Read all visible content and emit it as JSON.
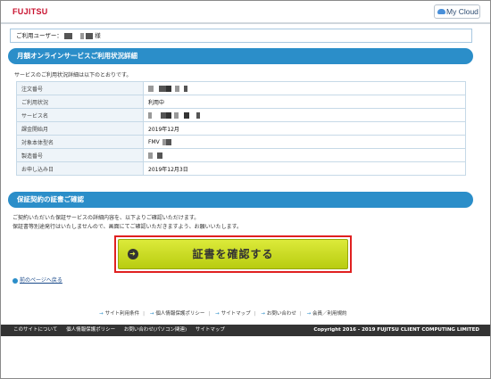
{
  "header": {
    "logo_text": "FUJITSU",
    "mycloud_label": "My Cloud"
  },
  "user": {
    "label": "ご利用ユーザー：",
    "suffix": "様"
  },
  "usage_section": {
    "title": "月額オンラインサービスご利用状況詳細",
    "intro": "サービスのご利用状況詳細は以下のとおりです。",
    "rows": [
      {
        "label": "注文番号",
        "value": ""
      },
      {
        "label": "ご利用状況",
        "value": "利用中"
      },
      {
        "label": "サービス名",
        "value": ""
      },
      {
        "label": "課金開始月",
        "value": "2019年12月"
      },
      {
        "label": "対象本体型名",
        "value": "FMV"
      },
      {
        "label": "製造番号",
        "value": ""
      },
      {
        "label": "お申し込み日",
        "value": "2019年12月3日"
      }
    ]
  },
  "warranty_section": {
    "title": "保証契約の証書ご確認",
    "desc_line1": "ご契約いただいた保証サービスの詳細内容を、以下よりご確認いただけます。",
    "desc_line2": "保証書等別途発行はいたしませんので、画面にてご確認いただきますよう、お願いいたします。",
    "confirm_button": "証書を確認する"
  },
  "back_link": "前のページへ戻る",
  "footer_nav": [
    "サイト利用条件",
    "個人情報保護ポリシー",
    "サイトマップ",
    "お問い合わせ",
    "会員／利用規約"
  ],
  "footer": {
    "links": [
      "このサイトについて",
      "個人情報保護ポリシー",
      "お問い合わせ(パソコン関連)",
      "サイトマップ"
    ],
    "copyright": "Copyright 2016 - 2019 FUJITSU CLIENT COMPUTING LIMITED"
  },
  "colors": {
    "brand_red": "#c8102e",
    "section_blue": "#2b8ec9",
    "button_yellow": "#c8dc20",
    "highlight_red": "#e02020"
  }
}
